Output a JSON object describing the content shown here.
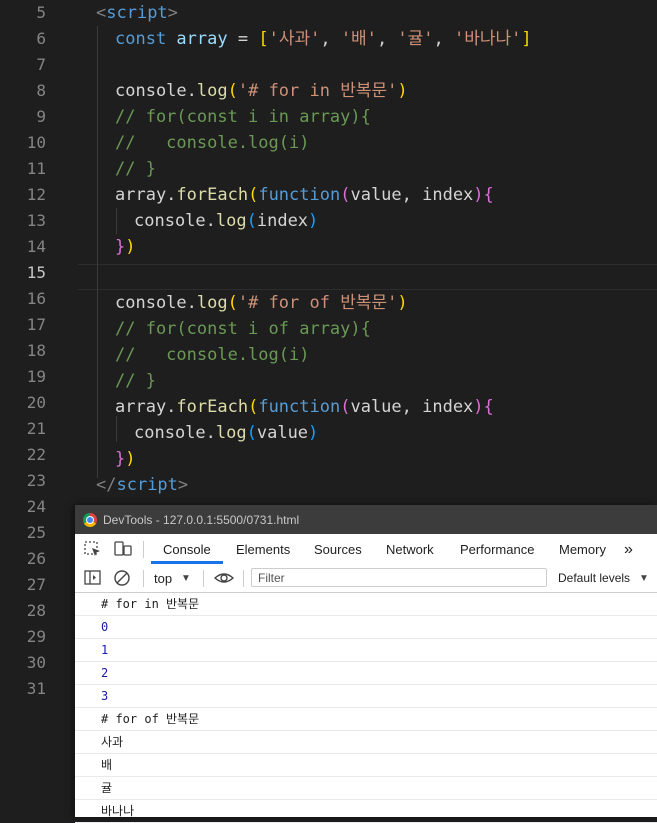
{
  "editor": {
    "line_numbers": [
      "5",
      "6",
      "7",
      "8",
      "9",
      "10",
      "11",
      "12",
      "13",
      "14",
      "15",
      "16",
      "17",
      "18",
      "19",
      "20",
      "21",
      "22",
      "23",
      "24",
      "25",
      "26",
      "27",
      "28",
      "29",
      "30",
      "31"
    ],
    "active_line": "15",
    "code": {
      "l5": {
        "open": "<",
        "tag": "script",
        "close": ">"
      },
      "l6": {
        "kw": "const",
        "name": " array ",
        "eq": "= ",
        "ob": "[",
        "s1": "'사과'",
        "c1": ", ",
        "s2": "'배'",
        "c2": ", ",
        "s3": "'귤'",
        "c3": ", ",
        "s4": "'바나나'",
        "cb": "]"
      },
      "l8": {
        "obj": "console.",
        "fn": "log",
        "op": "(",
        "str": "'# for in 반복문'",
        "cp": ")"
      },
      "l9": "// for(const i in array){",
      "l10": "//   console.log(i)",
      "l11": "// }",
      "l12": {
        "obj": "array.",
        "fn": "forEach",
        "op": "(",
        "kw": "function",
        "op2": "(",
        "params": "value, index",
        "cp2": ")",
        "brace": "{"
      },
      "l13": {
        "obj": "console.",
        "fn": "log",
        "op": "(",
        "arg": "index",
        "cp": ")"
      },
      "l14": {
        "brace": "}",
        "cp": ")"
      },
      "l16": {
        "obj": "console.",
        "fn": "log",
        "op": "(",
        "str": "'# for of 반복문'",
        "cp": ")"
      },
      "l17": "// for(const i of array){",
      "l18": "//   console.log(i)",
      "l19": "// }",
      "l20": {
        "obj": "array.",
        "fn": "forEach",
        "op": "(",
        "kw": "function",
        "op2": "(",
        "params": "value, index",
        "cp2": ")",
        "brace": "{"
      },
      "l21": {
        "obj": "console.",
        "fn": "log",
        "op": "(",
        "arg": "value",
        "cp": ")"
      },
      "l22": {
        "brace": "}",
        "cp": ")"
      },
      "l23": {
        "open": "</",
        "tag": "script",
        "close": ">"
      }
    }
  },
  "devtools": {
    "app_name": "DevTools",
    "title_separator": " - ",
    "url": "127.0.0.1:5500/0731.html",
    "tabs": [
      "Console",
      "Elements",
      "Sources",
      "Network",
      "Performance",
      "Memory"
    ],
    "active_tab": "Console",
    "more_tabs": "»",
    "context": "top",
    "filter_placeholder": "Filter",
    "levels_label": "Default levels",
    "messages": [
      "# for in 반복문",
      "0",
      "1",
      "2",
      "3",
      "# for of 반복문",
      "사과",
      "배",
      "귤",
      "바나나"
    ]
  },
  "colors": {
    "editor_bg": "#1e1e1e",
    "line_number": "#858585",
    "keyword": "#569cd6",
    "variable": "#9cdcfe",
    "string": "#ce9178",
    "comment": "#6a9955",
    "function": "#dcdcaa",
    "bracket_yellow": "#ffd700",
    "bracket_purple": "#da70d6",
    "bracket_blue": "#179fff",
    "tab_underline": "#1a73e8",
    "console_number": "#1a1aa6"
  },
  "icons": [
    "chrome-icon",
    "inspect-element-icon",
    "device-toolbar-icon",
    "more-tabs-icon",
    "sidebar-toggle-icon",
    "clear-console-icon",
    "dropdown-arrow-icon",
    "eye-icon",
    "dropdown-arrow-icon"
  ]
}
